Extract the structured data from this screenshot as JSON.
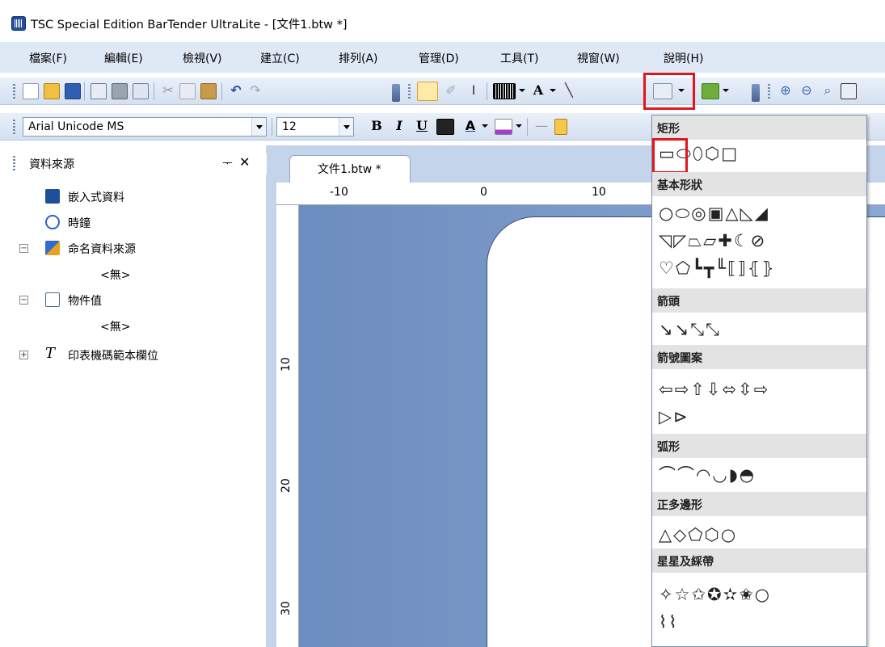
{
  "window": {
    "title": "TSC Special Edition BarTender UltraLite - [文件1.btw *]"
  },
  "menubar": {
    "items": [
      "檔案(F)",
      "編輯(E)",
      "檢視(V)",
      "建立(C)",
      "排列(A)",
      "管理(D)",
      "工具(T)",
      "視窗(W)",
      "說明(H)"
    ]
  },
  "toolbar2": {
    "font_name": "Arial Unicode MS",
    "font_size": "12"
  },
  "data_sources_panel": {
    "title": "資料來源",
    "pin": "ᅮ",
    "close": "✕",
    "items": [
      {
        "label": "嵌入式資料"
      },
      {
        "label": "時鐘"
      },
      {
        "label": "命名資料來源",
        "expander": "−"
      },
      {
        "label": "<無>"
      },
      {
        "label": "物件值",
        "expander": "−"
      },
      {
        "label": "<無>"
      },
      {
        "label": "印表機碼範本欄位",
        "expander": "+",
        "glyph": "T"
      }
    ]
  },
  "document": {
    "tab_label": "文件1.btw *",
    "ruler_top": [
      "-10",
      "0",
      "10"
    ],
    "ruler_left": [
      "10",
      "20",
      "30"
    ]
  },
  "shapes_menu": {
    "sections": [
      {
        "header": "矩形",
        "shapes": "▭⬭⬯⬡□"
      },
      {
        "header": "基本形狀",
        "rows": [
          "○⬭◎▣△◺◢",
          "◹◸⏢▱✚☾⊘",
          "♡⬠┗┳╙⟦⟧⦃⦄"
        ]
      },
      {
        "header": "箭頭",
        "rows": [
          "↘↘⤡⤡"
        ]
      },
      {
        "header": "箭號圖案",
        "rows": [
          "⇦⇨⇧⇩⬄⇳⇨",
          "▷⊳"
        ]
      },
      {
        "header": "弧形",
        "rows": [
          "⌒⌒◠◡◗◓"
        ]
      },
      {
        "header": "正多邊形",
        "rows": [
          "△◇⬠⬡○"
        ]
      },
      {
        "header": "星星及綵帶",
        "rows": [
          "✧☆✩✪✫✬○",
          "⌇⌇"
        ]
      }
    ]
  },
  "colors": {
    "menubar_bg": "#dfe8f5",
    "toolbar_bg": "#d5e0f0",
    "canvas_bg": "#7896c8",
    "highlight": "#e3141b",
    "menu_header_bg": "#e3e3e3"
  }
}
